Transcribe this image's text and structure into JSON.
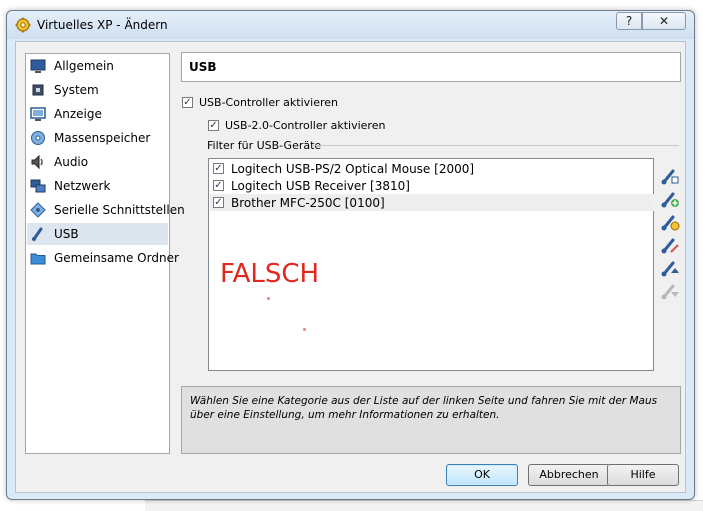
{
  "window": {
    "title": "Virtuelles XP - Ändern",
    "help_label": "?",
    "close_label": "✕"
  },
  "sidebar": {
    "items": [
      {
        "label": "Allgemein",
        "icon": "monitor-icon"
      },
      {
        "label": "System",
        "icon": "chip-icon"
      },
      {
        "label": "Anzeige",
        "icon": "display-icon"
      },
      {
        "label": "Massenspeicher",
        "icon": "disk-icon"
      },
      {
        "label": "Audio",
        "icon": "speaker-icon"
      },
      {
        "label": "Netzwerk",
        "icon": "network-icon"
      },
      {
        "label": "Serielle Schnittstellen",
        "icon": "serial-icon"
      },
      {
        "label": "USB",
        "icon": "usb-icon"
      },
      {
        "label": "Gemeinsame Ordner",
        "icon": "folder-icon"
      }
    ],
    "selected": "USB"
  },
  "page": {
    "header": "USB",
    "usb_controller_label": "USB-Controller aktivieren",
    "usb2_controller_label": "USB-2.0-Controller aktivieren",
    "filter_label": "Filter für USB-Geräte",
    "filters": [
      {
        "label": "Logitech USB-PS/2 Optical Mouse [2000]",
        "checked": true
      },
      {
        "label": "Logitech USB Receiver [3810]",
        "checked": true
      },
      {
        "label": "Brother MFC-250C [0100]",
        "checked": true
      }
    ],
    "overlay_text": "FALSCH",
    "check_mark": "✓",
    "info_text": "Wählen Sie eine Kategorie aus der Liste auf der linken Seite und fahren Sie mit der Maus über eine Einstellung, um mehr Informationen zu erhalten."
  },
  "side_icons": [
    "usb-add-filter-icon",
    "usb-add-from-device-icon",
    "usb-edit-filter-icon",
    "usb-remove-filter-icon",
    "usb-move-up-icon",
    "usb-move-down-icon"
  ],
  "buttons": {
    "ok": "OK",
    "cancel": "Abbrechen",
    "help": "Hilfe"
  },
  "colors": {
    "overlay_text": "#e1271f",
    "selection": "#dde5ee",
    "window_frame": "#dce9f6"
  }
}
